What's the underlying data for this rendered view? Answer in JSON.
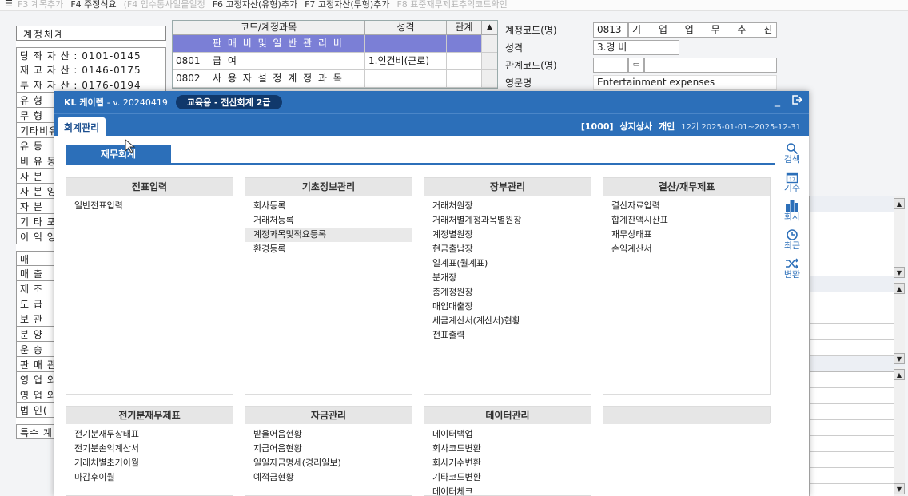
{
  "bg_toolbar": {
    "items": [
      "F3 계목추가",
      "F4 주정식요",
      "(F4 입수통사일물일정",
      "F6 고정자산(유형)추가",
      "F7 고정자산(무형)추가",
      "F8 표준재무제표추익코드확인"
    ],
    "dim_flags": [
      true,
      false,
      true,
      false,
      false,
      true
    ]
  },
  "bg_left": {
    "header": "계정체계",
    "rows_top": [
      "당 좌 자 산 : 0101-0145",
      "재 고 자 산 : 0146-0175",
      "투 자 자 산 : 0176-0194",
      "유 형",
      "무 형",
      "기타비유",
      "유 동",
      "비 유 동",
      "자 본",
      "자 본 잉",
      "자 본",
      "기 타 포",
      "이 익 잉"
    ],
    "rows_mid": [
      "매",
      "매 출",
      "제 조",
      "도 급",
      "보 관",
      "분 양",
      "운 송",
      "판 매 관",
      "영 업 외",
      "영 업 외",
      "법 인("
    ],
    "row_bottom": "특수 계"
  },
  "bg_table": {
    "headers": [
      "코드/계정과목",
      "성격",
      "관계"
    ],
    "rows": [
      {
        "code": "",
        "name": "판 매 비 및 일 반 관 리 비",
        "nature": "",
        "rel": "",
        "selected": true
      },
      {
        "code": "0801",
        "name": "급                        여",
        "nature": "1.인건비(근로)",
        "rel": "",
        "selected": false
      },
      {
        "code": "0802",
        "name": "사 용 자 설 정 계 정 과 목",
        "nature": "",
        "rel": "",
        "selected": false
      }
    ]
  },
  "bg_detail": {
    "code_label": "계정코드(명)",
    "code_value": "0813",
    "code_name": "기 업 업 무 추 진 비",
    "nature_label": "성격",
    "nature_value": "3.경        비",
    "rel_label": "관계코드(명)",
    "eng_label": "영문명",
    "eng_value": "Entertainment expenses"
  },
  "modal": {
    "logo": "KL 케이렙",
    "version": "- v.  20240419",
    "edition": "교육용 - 전산회계 2급",
    "tab": "회계관리",
    "company_code": "[1000]",
    "company_name": "상지상사",
    "company_type": "개인",
    "period": "12기 2025-01-01~2025-12-31",
    "finance_tab": "재무회계"
  },
  "panels": [
    {
      "title": "전표입력",
      "items": [
        "일반전표입력"
      ],
      "highlight": -1
    },
    {
      "title": "기초정보관리",
      "items": [
        "회사등록",
        "거래처등록",
        "계정과목및적요등록",
        "환경등록"
      ],
      "highlight": 2
    },
    {
      "title": "장부관리",
      "items": [
        "거래처원장",
        "거래처별계정과목별원장",
        "계정별원장",
        "현금출납장",
        "일계표(월계표)",
        "분개장",
        "총계정원장",
        "매입매출장",
        "세금계산서(계산서)현황",
        "전표출력"
      ],
      "highlight": -1
    },
    {
      "title": "결산/재무제표",
      "items": [
        "결산자료입력",
        "합계잔액시산표",
        "재무상태표",
        "손익계산서"
      ],
      "highlight": -1
    },
    {
      "title": "전기분재무제표",
      "items": [
        "전기분재무상태표",
        "전기분손익계산서",
        "거래처별초기이월",
        "마감후이월"
      ],
      "highlight": -1
    },
    {
      "title": "자금관리",
      "items": [
        "받을어음현황",
        "지급어음현황",
        "일일자금명세(경리일보)",
        "예적금현황"
      ],
      "highlight": -1
    },
    {
      "title": "데이터관리",
      "items": [
        "데이터백업",
        "회사코드변환",
        "회사기수변환",
        "기타코드변환",
        "데이터체크"
      ],
      "highlight": -1
    },
    {
      "title": "",
      "items": [],
      "highlight": -1
    }
  ],
  "side_icons": [
    {
      "icon": "search-icon",
      "label": "검색"
    },
    {
      "icon": "calendar-icon",
      "label": "기수"
    },
    {
      "icon": "building-icon",
      "label": "회사"
    },
    {
      "icon": "clock-icon",
      "label": "최근"
    },
    {
      "icon": "shuffle-icon",
      "label": "변환"
    }
  ],
  "colors": {
    "accent": "#2c6fb9",
    "selected_row": "#7b7fd6",
    "pill": "#10386b"
  }
}
